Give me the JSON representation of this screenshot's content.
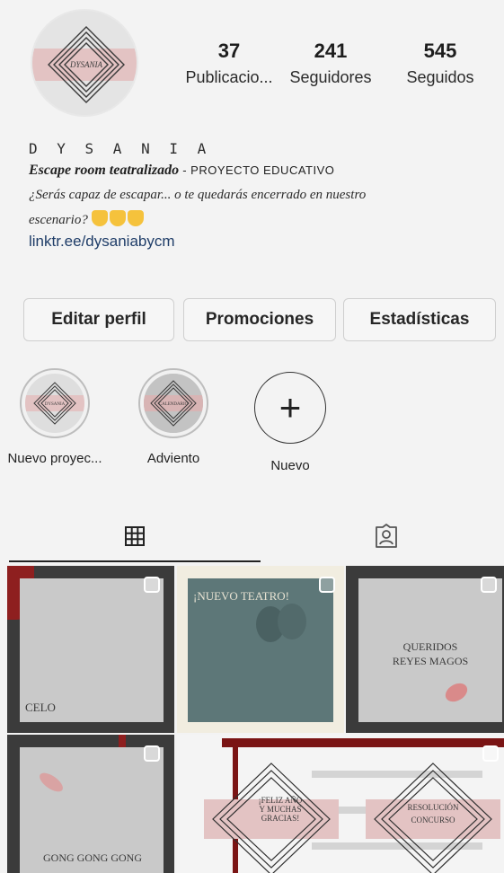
{
  "profile": {
    "avatar_text": "DYSANIA",
    "stats": [
      {
        "count": "37",
        "label": "Publicacio..."
      },
      {
        "count": "241",
        "label": "Seguidores"
      },
      {
        "count": "545",
        "label": "Seguidos"
      }
    ],
    "name": "D Y S A N I A",
    "tagline_italic": "Escape room teatralizado",
    "tagline_rest": " - PROYECTO EDUCATIVO",
    "description_1": "¿Serás capaz de escapar... o te quedarás encerrado en nuestro",
    "description_2": "escenario?",
    "link": "linktr.ee/dysaniabycm"
  },
  "buttons": {
    "edit": "Editar perfil",
    "promotions": "Promociones",
    "stats": "Estadísticas"
  },
  "highlights": [
    {
      "label": "Nuevo proyec...",
      "cover_text": "DYSANIA"
    },
    {
      "label": "Adviento",
      "cover_text": "CALENDARIO"
    },
    {
      "label": "Nuevo"
    }
  ],
  "tabs": {
    "grid_icon": "grid-icon",
    "tagged_icon": "tagged-person-icon"
  },
  "posts": [
    {
      "text": "CELO"
    },
    {
      "text": "¡NUEVO TEATRO!"
    },
    {
      "text_1": "QUERIDOS",
      "text_2": "REYES MAGOS"
    },
    {
      "text": "GONG GONG GONG"
    },
    {
      "text_1": "¡FELIZ AÑO",
      "text_2": "Y MUCHAS",
      "text_3": "GRACIAS!",
      "text_4": "RESOLUCIÓN",
      "text_5": "CONCURSO"
    }
  ],
  "colors": {
    "pink_band": "#e3c3c3",
    "teal_post": "#5d7778",
    "dark_frame": "#3a3a3a",
    "link": "#1f3d68"
  }
}
